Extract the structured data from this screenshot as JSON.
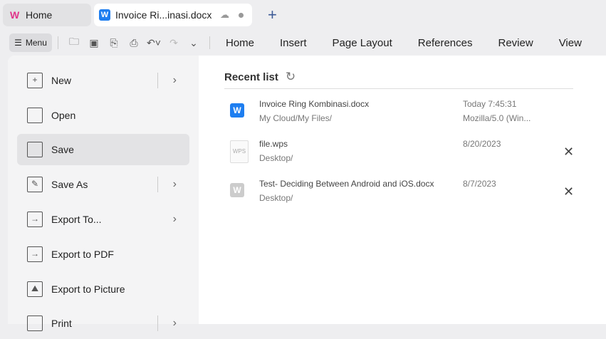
{
  "tabs": {
    "home": "Home",
    "doc": "Invoice Ri...inasi.docx"
  },
  "toolbar": {
    "menu": "Menu",
    "ribbon": [
      "Home",
      "Insert",
      "Page Layout",
      "References",
      "Review",
      "View"
    ]
  },
  "menu": {
    "items": [
      {
        "label": "New",
        "arrow": true
      },
      {
        "label": "Open"
      },
      {
        "label": "Save",
        "selected": true
      },
      {
        "label": "Save As",
        "arrow": true
      },
      {
        "label": "Export To...",
        "arrow": true
      },
      {
        "label": "Export to PDF"
      },
      {
        "label": "Export to Picture"
      },
      {
        "label": "Print",
        "arrow": true
      }
    ]
  },
  "recent": {
    "title": "Recent list",
    "files": [
      {
        "name": "Invoice Ring Kombinasi.docx",
        "path": "My Cloud/My Files/",
        "date": "Today 7:45:31",
        "device": "Mozilla/5.0 (Win..."
      },
      {
        "name": "file.wps",
        "path": "Desktop/",
        "date": "8/20/2023"
      },
      {
        "name": "Test- Deciding Between Android and iOS.docx",
        "path": "Desktop/",
        "date": "8/7/2023"
      }
    ]
  },
  "colors": {
    "accent": "#1e7ef0"
  }
}
